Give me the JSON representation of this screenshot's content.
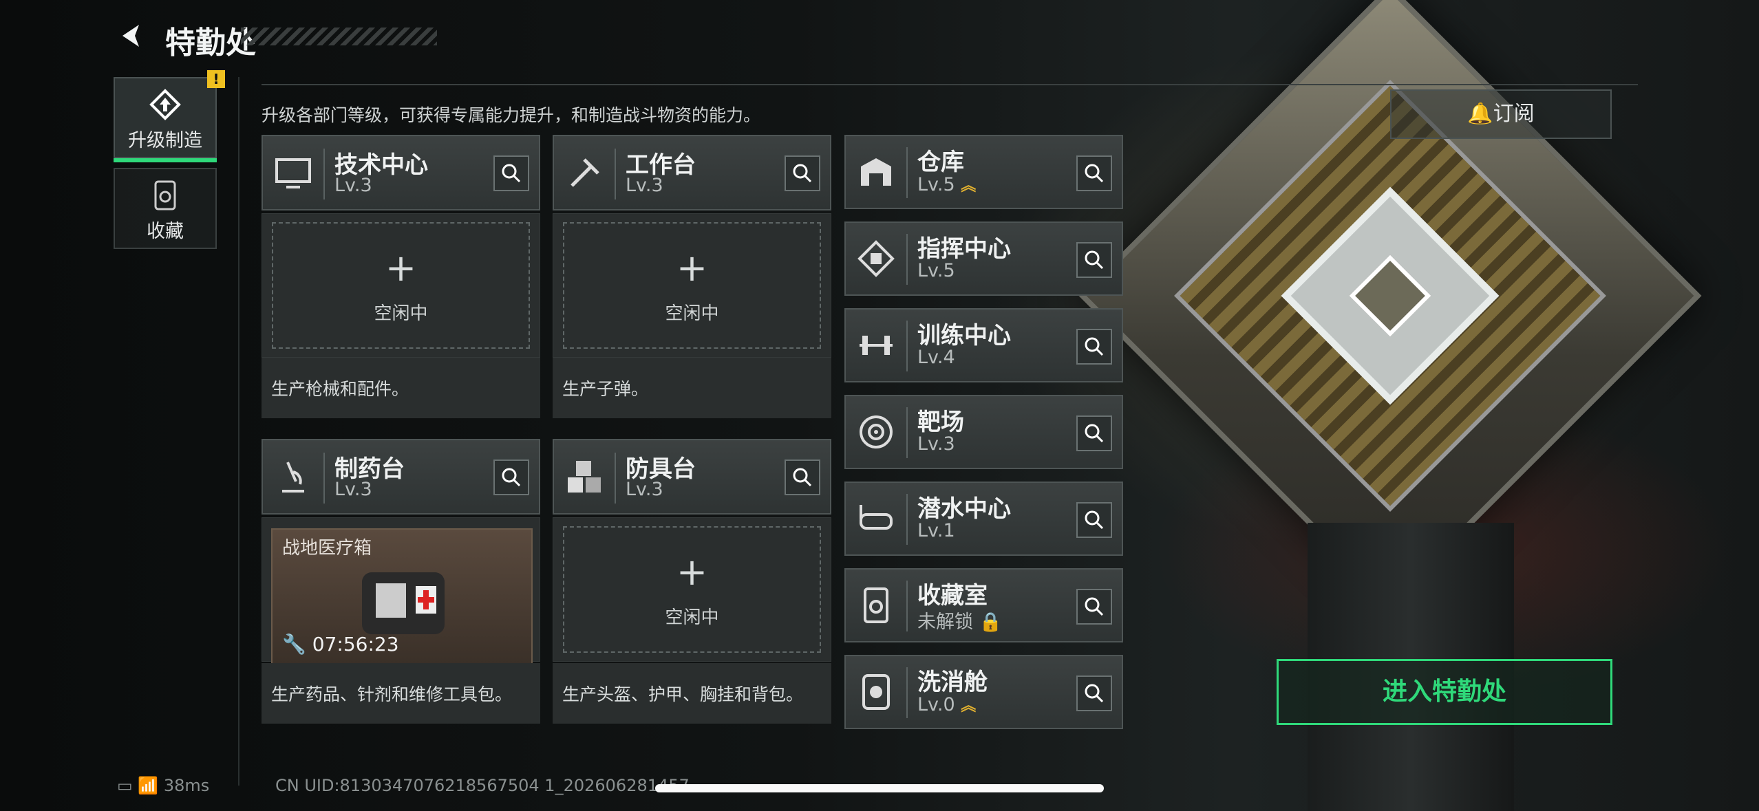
{
  "header": {
    "title": "特勤处"
  },
  "tabs": [
    {
      "label": "升级制造",
      "badge": "!"
    },
    {
      "label": "收藏"
    }
  ],
  "description": "升级各部门等级，可获得专属能力提升，和制造战斗物资的能力。",
  "subscribe_label": "订阅",
  "enter_label": "进入特勤处",
  "stations": [
    {
      "name": "技术中心",
      "level": "Lv.3",
      "slot": "空闲中",
      "caption": "生产枪械和配件。"
    },
    {
      "name": "工作台",
      "level": "Lv.3",
      "slot": "空闲中",
      "caption": "生产子弹。"
    },
    {
      "name": "制药台",
      "level": "Lv.3",
      "item": "战地医疗箱",
      "timer": "07:56:23",
      "caption": "生产药品、针剂和维修工具包。"
    },
    {
      "name": "防具台",
      "level": "Lv.3",
      "slot": "空闲中",
      "caption": "生产头盔、护甲、胸挂和背包。"
    }
  ],
  "facilities": [
    {
      "name": "仓库",
      "level": "Lv.5",
      "upgrade": true
    },
    {
      "name": "指挥中心",
      "level": "Lv.5"
    },
    {
      "name": "训练中心",
      "level": "Lv.4"
    },
    {
      "name": "靶场",
      "level": "Lv.3"
    },
    {
      "name": "潜水中心",
      "level": "Lv.1"
    },
    {
      "name": "收藏室",
      "level": "未解锁",
      "locked": true
    },
    {
      "name": "洗消舱",
      "level": "Lv.0",
      "upgrade": true
    }
  ],
  "status": {
    "ping": "38ms",
    "uid": "CN UID:8130347076218567504 1_202606281457"
  },
  "colors": {
    "accent": "#2fd97a",
    "warning": "#f0c020"
  }
}
